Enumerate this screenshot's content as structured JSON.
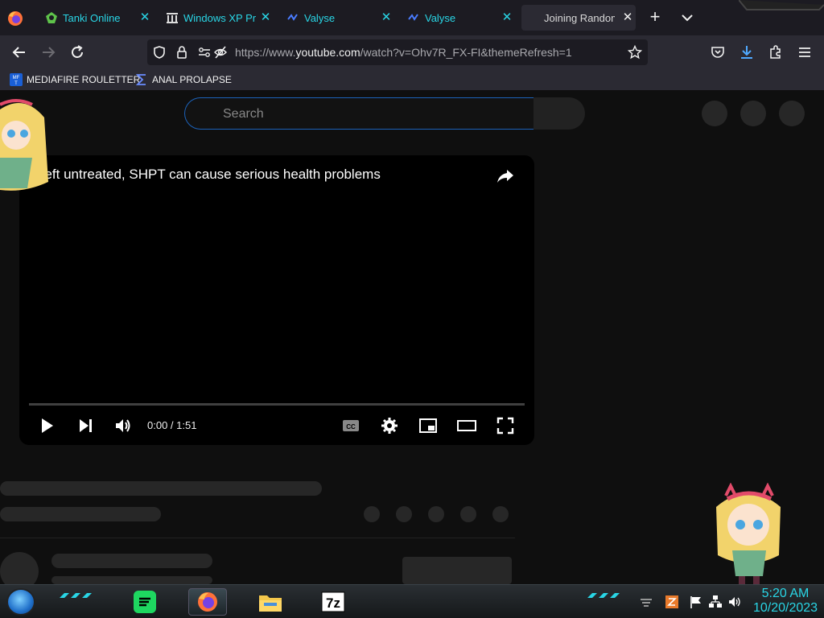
{
  "browser": {
    "tabs": [
      {
        "label": "Tanki Online",
        "icon": "tanki-icon",
        "active": false
      },
      {
        "label": "Windows XP Pro",
        "icon": "archive-icon",
        "active": false
      },
      {
        "label": "Valyse",
        "icon": "valyse-icon",
        "active": false
      },
      {
        "label": "Valyse",
        "icon": "valyse-icon",
        "active": false
      },
      {
        "label": "Joining Random",
        "icon": "",
        "active": true
      }
    ],
    "url_prefix": "https://www.",
    "url_domain": "youtube.com",
    "url_path": "/watch?v=Ohv7R_FX-FI&themeRefresh=1",
    "bookmarks": [
      {
        "label": "MEDIAFIRE ROULETTER",
        "icon": "mediafire-icon"
      },
      {
        "label": "ANAL PROLAPSE",
        "icon": "sigma-icon"
      }
    ],
    "accent_color": "#29d6e6"
  },
  "youtube": {
    "search_placeholder": "Search",
    "video": {
      "title": "Left untreated, SHPT can cause serious health problems",
      "time": "0:00 / 1:51",
      "progress": 0
    }
  },
  "taskbar": {
    "apps": [
      "start-orb",
      "spotify-icon",
      "firefox-icon",
      "file-explorer-icon",
      "7zip-icon"
    ],
    "seven_zip_label": "7z",
    "clock_time": "5:20 AM",
    "clock_date": "10/20/2023"
  }
}
